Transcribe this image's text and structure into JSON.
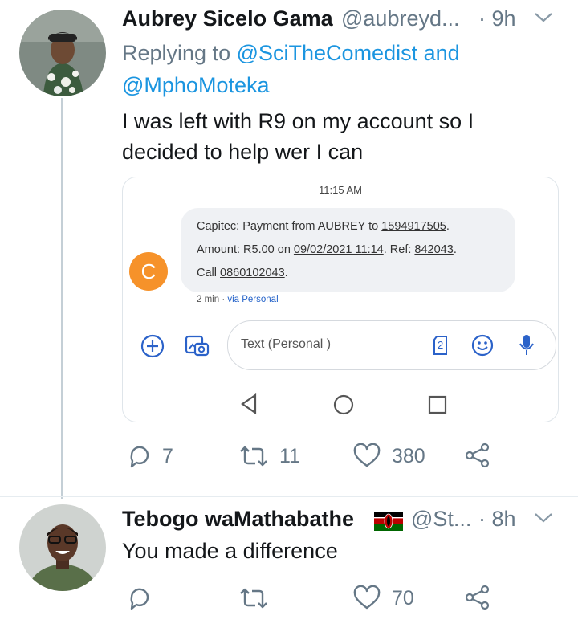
{
  "tweet1": {
    "name": "Aubrey Sicelo Gama",
    "handle": "@aubreyd...",
    "time": "· 9h",
    "replying_prefix": "Replying to",
    "mention1": "@SciTheComedist",
    "and_word": "and",
    "mention2": "@MphoMoteka",
    "text_line1": "I was left with R9 on my account so I",
    "text_line2": "decided to help wer I can",
    "reply_count": "7",
    "retweet_count": "11",
    "like_count": "380"
  },
  "sms_card": {
    "time": "11:15 AM",
    "sender_initial": "C",
    "l1_a": "Capitec: Payment from AUBREY to ",
    "l1_b": "1594917505",
    "l1_c": ".",
    "l2_a": "Amount: R5.00 on ",
    "l2_b": "09/02/2021 11:14",
    "l2_c": ". Ref: ",
    "l2_d": "842043",
    "l2_e": ".",
    "l3_a": "Call ",
    "l3_b": "0860102043",
    "l3_c": ".",
    "meta_age": "2 min · ",
    "meta_via": "via Personal",
    "input_placeholder": "Text (Personal )",
    "sim_number": "2"
  },
  "tweet2": {
    "name": "Tebogo waMathabathe",
    "handle": "@St...",
    "time": "· 8h",
    "text": "You made a difference",
    "like_count": "70"
  },
  "colors": {
    "mention": "#1b95e0",
    "icon_gray": "#657786",
    "sms_icon_blue": "#2b62c9",
    "sender_avatar": "#f6922a"
  }
}
